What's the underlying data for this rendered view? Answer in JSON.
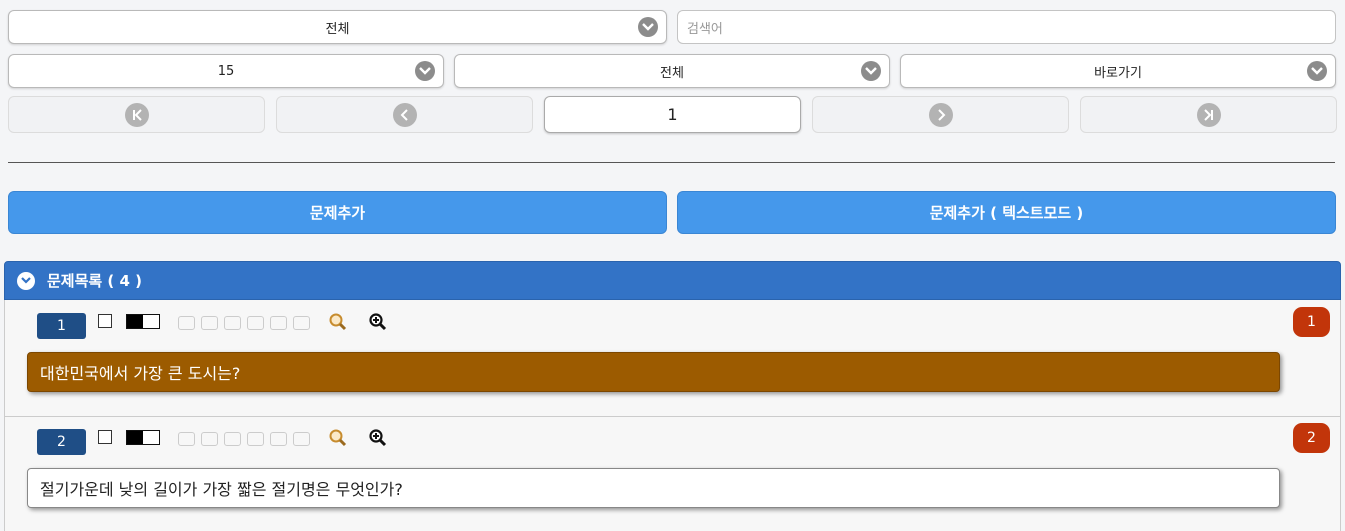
{
  "filters": {
    "category": "전체",
    "search_placeholder": "검색어",
    "per_page": "15",
    "type": "전체",
    "goto": "바로가기"
  },
  "pager": {
    "current_page": "1"
  },
  "actions": {
    "add_question": "문제추가",
    "add_question_text_mode": "문제추가 ( 텍스트모드 )"
  },
  "question_list": {
    "title": "문제목록 ( 4 )",
    "items": [
      {
        "number": "1",
        "badge": "1",
        "text": "대한민국에서 가장 큰 도시는?"
      },
      {
        "number": "2",
        "badge": "2",
        "text": "절기가운데 낮의 길이가 가장 짧은 절기명은 무엇인가?"
      }
    ]
  },
  "colors": {
    "primary_button": "#4598eb",
    "panel_header": "#3373c6",
    "selected_question": "#9c5b00",
    "badge": "#c2350a",
    "question_number": "#1f4e86"
  }
}
